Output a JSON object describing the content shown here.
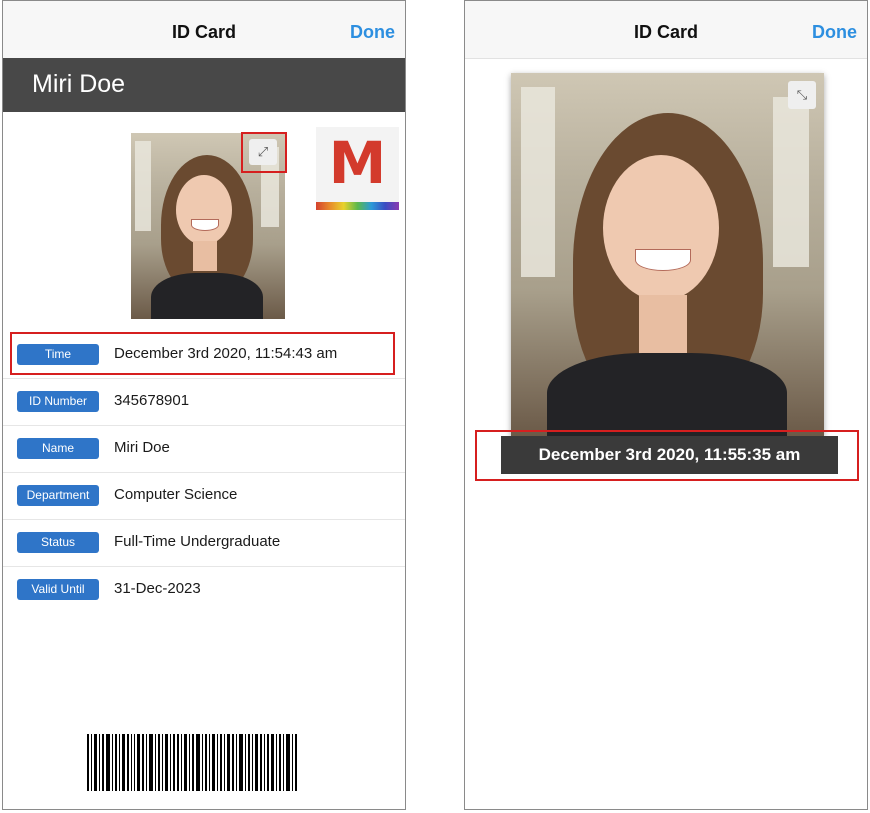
{
  "left_screen": {
    "nav": {
      "title": "ID Card",
      "done_label": "Done"
    },
    "name_banner": "Miri Doe",
    "photo_expand_icon": "expand-arrows-icon",
    "logo_letter": "M",
    "fields": [
      {
        "label": "Time",
        "value": "December 3rd 2020, 11:54:43 am"
      },
      {
        "label": "ID Number",
        "value": "345678901"
      },
      {
        "label": "Name",
        "value": "Miri Doe"
      },
      {
        "label": "Department",
        "value": "Computer Science"
      },
      {
        "label": "Status",
        "value": "Full-Time Undergraduate"
      },
      {
        "label": "Valid Until",
        "value": "31-Dec-2023"
      }
    ]
  },
  "right_screen": {
    "nav": {
      "title": "ID Card",
      "done_label": "Done"
    },
    "photo_collapse_icon": "collapse-arrows-icon",
    "time_caption": "December 3rd 2020, 11:55:35 am"
  },
  "colors": {
    "accent": "#2d8fe0",
    "badge": "#2f75c8",
    "banner": "#484848",
    "highlight": "#d61f1f",
    "logo_red": "#d33a2c"
  }
}
